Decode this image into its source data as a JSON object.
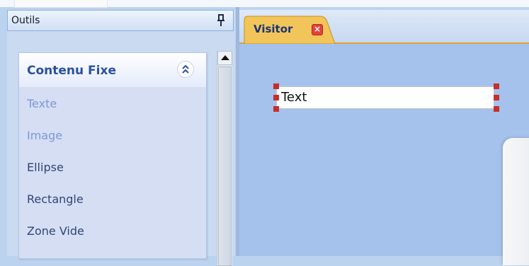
{
  "tools_panel": {
    "title": "Outils",
    "pin_icon": "pin-icon",
    "section": {
      "title": "Contenu Fixe",
      "collapse_icon": "double-chevron-up-icon",
      "items": [
        {
          "label": "Texte",
          "state": "disabled"
        },
        {
          "label": "Image",
          "state": "disabled"
        },
        {
          "label": "Ellipse",
          "state": "enabled"
        },
        {
          "label": "Rectangle",
          "state": "enabled"
        },
        {
          "label": "Zone Vide",
          "state": "enabled"
        }
      ]
    }
  },
  "document": {
    "tab": {
      "label": "Visitor",
      "close_symbol": "×"
    },
    "textbox": {
      "text": "Text"
    }
  },
  "colors": {
    "accent": "#e8a12a",
    "section_title": "#2a4fa0",
    "disabled_item": "#7d98d6",
    "enabled_item": "#2f4676",
    "selection_handle": "#c62f2f",
    "tab_close": "#e5413b"
  }
}
